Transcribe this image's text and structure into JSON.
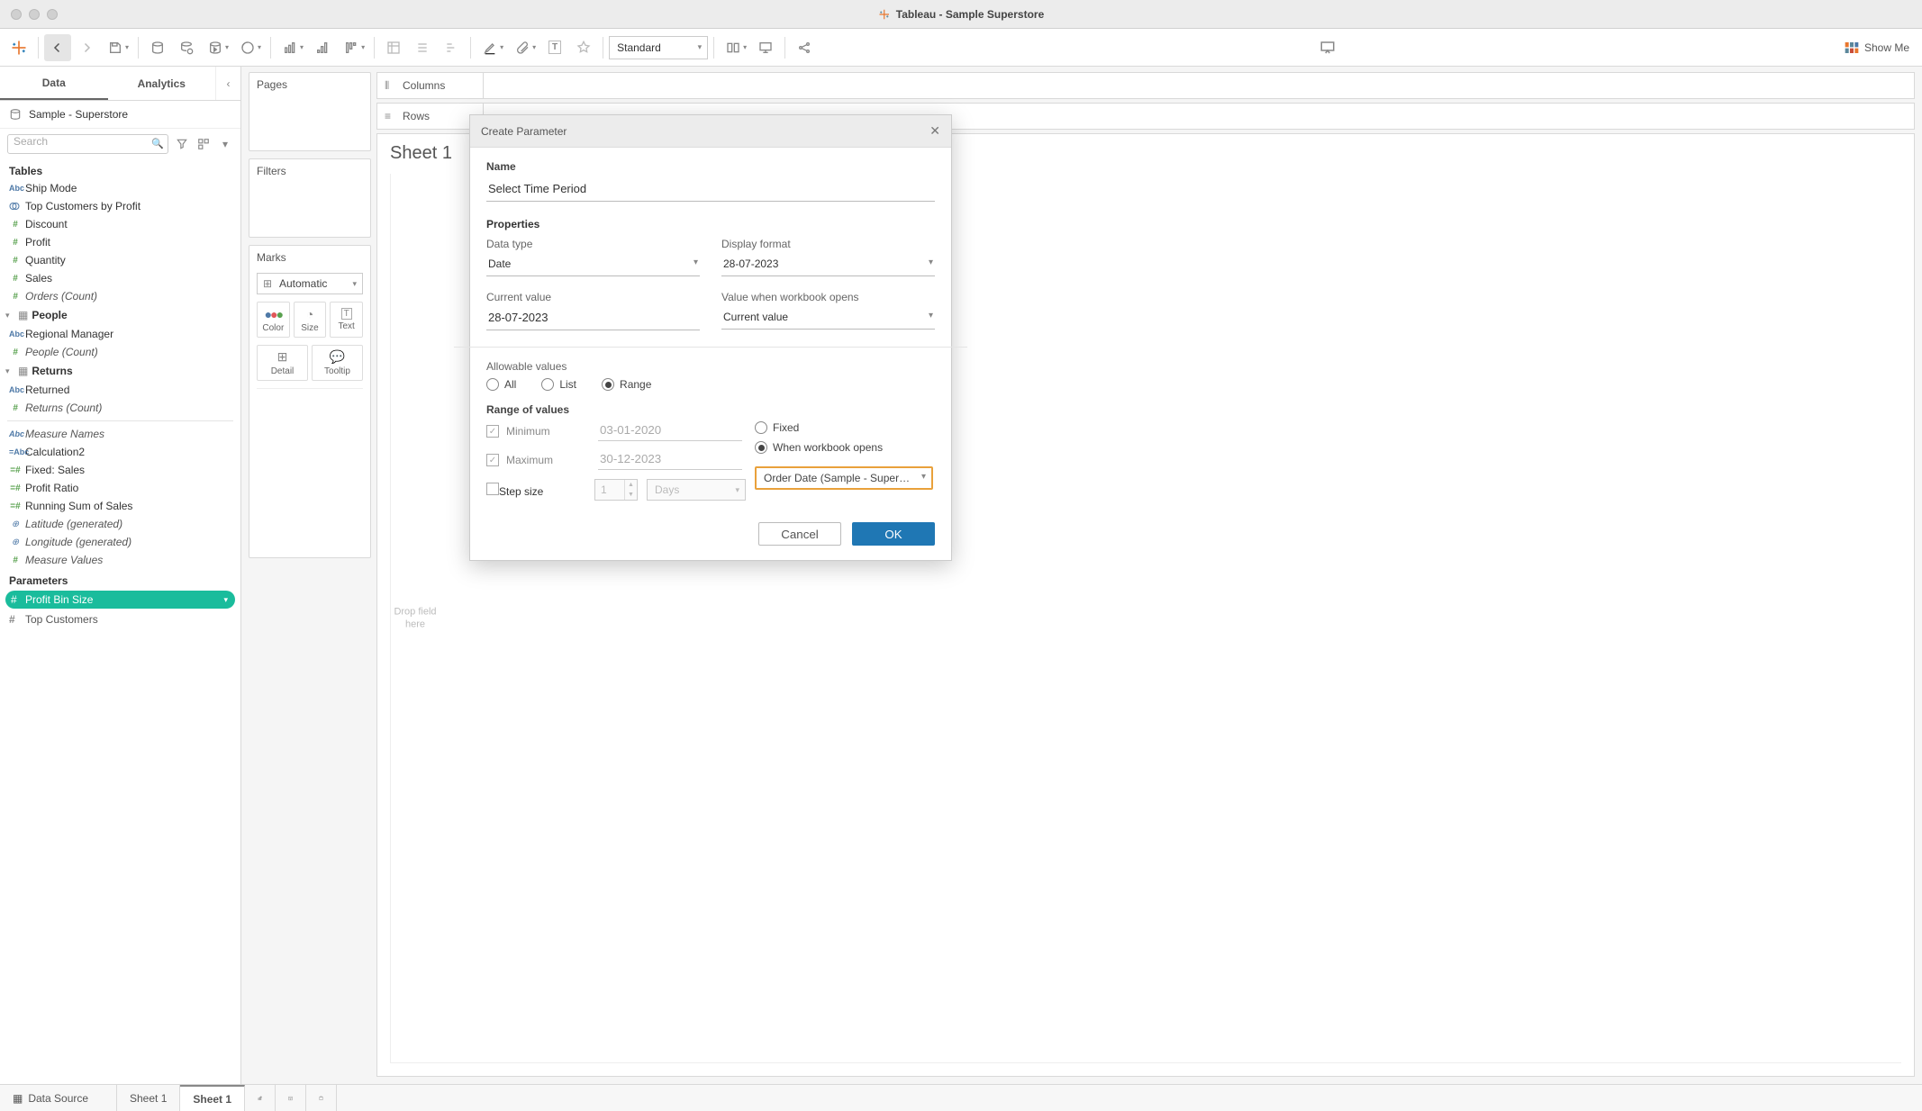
{
  "window": {
    "title": "Tableau - Sample Superstore"
  },
  "toolbar": {
    "fit_mode": "Standard",
    "showme": "Show Me"
  },
  "leftpane": {
    "tabs": {
      "data": "Data",
      "analytics": "Analytics"
    },
    "datasource": "Sample - Superstore",
    "search_placeholder": "Search",
    "tables_header": "Tables",
    "fields_top": [
      {
        "icon": "abc",
        "label": "Ship Mode"
      },
      {
        "icon": "set",
        "label": "Top Customers by Profit"
      },
      {
        "icon": "hash",
        "label": "Discount"
      },
      {
        "icon": "hash",
        "label": "Profit"
      },
      {
        "icon": "hash",
        "label": "Quantity"
      },
      {
        "icon": "hash",
        "label": "Sales"
      },
      {
        "icon": "hash",
        "label": "Orders (Count)",
        "italic": true
      }
    ],
    "groups": [
      {
        "name": "People",
        "fields": [
          {
            "icon": "abc",
            "label": "Regional Manager"
          },
          {
            "icon": "hash",
            "label": "People (Count)",
            "italic": true
          }
        ]
      },
      {
        "name": "Returns",
        "fields": [
          {
            "icon": "abc",
            "label": "Returned"
          },
          {
            "icon": "hash",
            "label": "Returns (Count)",
            "italic": true
          }
        ]
      }
    ],
    "loose_fields": [
      {
        "icon": "abc",
        "label": "Measure Names",
        "italic": true
      },
      {
        "icon": "calc",
        "label": "Calculation2"
      },
      {
        "icon": "hash",
        "label": "Fixed: Sales"
      },
      {
        "icon": "hash",
        "label": "Profit Ratio"
      },
      {
        "icon": "hash",
        "label": "Running Sum of Sales"
      },
      {
        "icon": "globe",
        "label": "Latitude (generated)",
        "italic": true
      },
      {
        "icon": "globe",
        "label": "Longitude (generated)",
        "italic": true
      },
      {
        "icon": "hash",
        "label": "Measure Values",
        "italic": true
      }
    ],
    "parameters_header": "Parameters",
    "parameters": [
      {
        "label": "Profit Bin Size",
        "pill": true
      },
      {
        "label": "Top Customers",
        "pill": false
      }
    ]
  },
  "shelves": {
    "pages": "Pages",
    "filters": "Filters",
    "marks": "Marks",
    "mark_type": "Automatic",
    "mark_buttons": [
      "Color",
      "Size",
      "Text",
      "Detail",
      "Tooltip"
    ],
    "columns": "Columns",
    "rows": "Rows"
  },
  "canvas": {
    "sheet_title": "Sheet 1",
    "drop_hint": "Drop field here"
  },
  "bottom": {
    "datasource": "Data Source",
    "sheet1": "Sheet 1",
    "sheet1_active": "Sheet 1"
  },
  "dialog": {
    "title": "Create Parameter",
    "name_label": "Name",
    "name_value": "Select Time Period",
    "properties": "Properties",
    "data_type_label": "Data type",
    "data_type_value": "Date",
    "display_format_label": "Display format",
    "display_format_value": "28-07-2023",
    "current_value_label": "Current value",
    "current_value_value": "28-07-2023",
    "workbook_open_label": "Value when workbook opens",
    "workbook_open_value": "Current value",
    "allowable_label": "Allowable values",
    "allow_all": "All",
    "allow_list": "List",
    "allow_range": "Range",
    "range_header": "Range of values",
    "min_label": "Minimum",
    "min_value": "03-01-2020",
    "max_label": "Maximum",
    "max_value": "30-12-2023",
    "fixed_label": "Fixed",
    "when_open_label": "When workbook opens",
    "order_date_value": "Order Date (Sample - Superstore)",
    "step_label": "Step size",
    "step_value": "1",
    "step_unit": "Days",
    "cancel": "Cancel",
    "ok": "OK"
  }
}
